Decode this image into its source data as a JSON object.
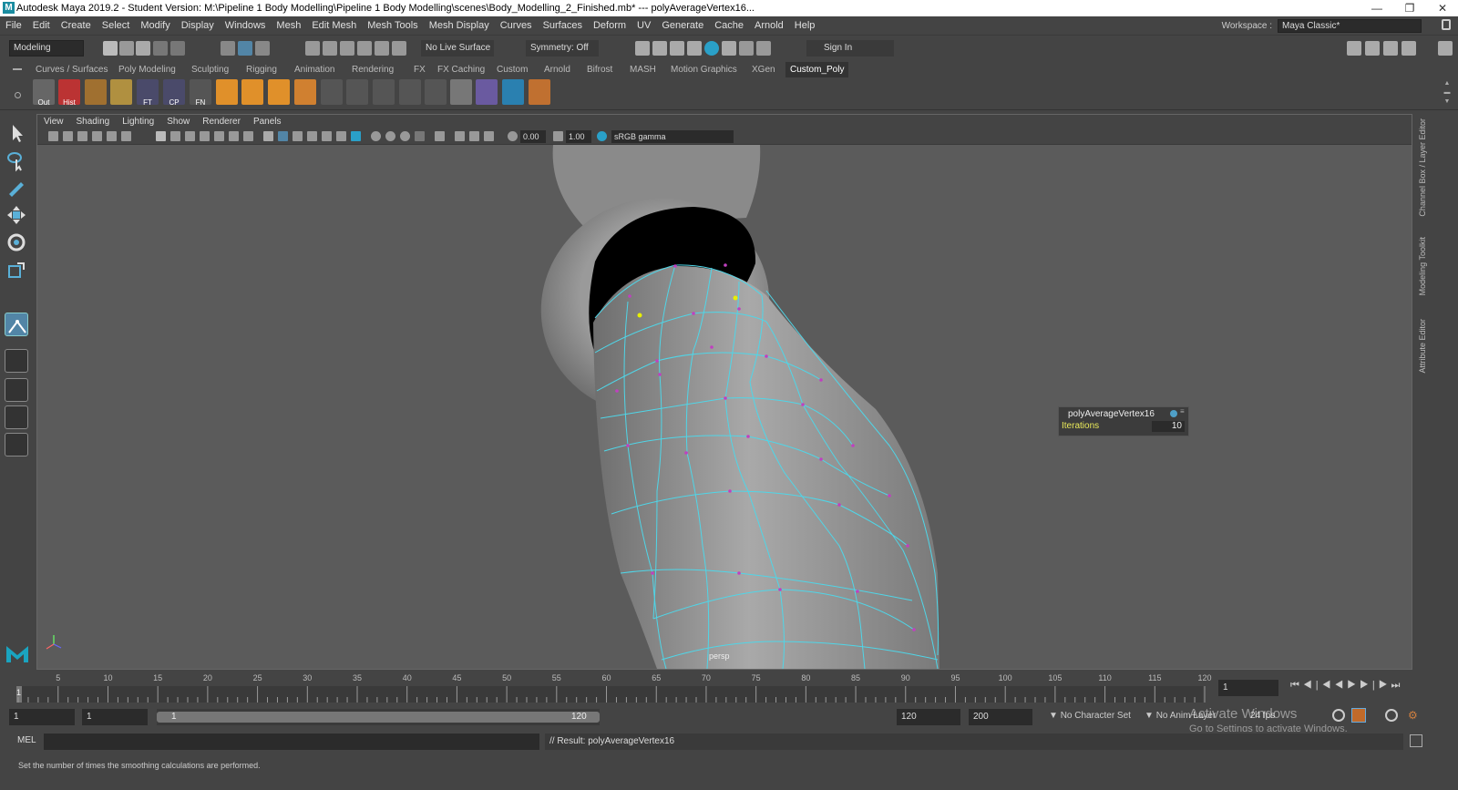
{
  "window": {
    "title": "Autodesk Maya 2019.2 - Student Version: M:\\Pipeline 1 Body Modelling\\Pipeline 1 Body Modelling\\scenes\\Body_Modelling_2_Finished.mb*   ---   polyAverageVertex16...",
    "min_icon": "minimize-icon",
    "max_icon": "maximize-icon",
    "close_icon": "close-icon"
  },
  "menu": [
    "File",
    "Edit",
    "Create",
    "Select",
    "Modify",
    "Display",
    "Windows",
    "Mesh",
    "Edit Mesh",
    "Mesh Tools",
    "Mesh Display",
    "Curves",
    "Surfaces",
    "Deform",
    "UV",
    "Generate",
    "Cache",
    "Arnold",
    "Help"
  ],
  "workspace": {
    "label": "Workspace :",
    "value": "Maya Classic*"
  },
  "status": {
    "mode": "Modeling",
    "live_surface": "No Live Surface",
    "symmetry": "Symmetry: Off",
    "sign_in": "Sign In"
  },
  "shelf_tabs": [
    "Curves / Surfaces",
    "Poly Modeling",
    "Sculpting",
    "Rigging",
    "Animation",
    "Rendering",
    "FX",
    "FX Caching",
    "Custom",
    "Arnold",
    "Bifrost",
    "MASH",
    "Motion Graphics",
    "XGen",
    "Custom_Poly"
  ],
  "shelf_active": "Custom_Poly",
  "shelf_icons": [
    "Out",
    "Hist",
    "",
    "",
    "FT",
    "CP",
    "FN"
  ],
  "viewport": {
    "menu": [
      "View",
      "Shading",
      "Lighting",
      "Show",
      "Renderer",
      "Panels"
    ],
    "exposure": "0.00",
    "gamma": "1.00",
    "colorspace": "sRGB gamma",
    "camera": "persp"
  },
  "hud": {
    "node": "polyAverageVertex16",
    "attr": "Iterations",
    "value": "10"
  },
  "right_panels": [
    "Channel Box / Layer Editor",
    "Modeling Toolkit",
    "Attribute Editor"
  ],
  "timeline": {
    "ticks": [
      "5",
      "10",
      "15",
      "20",
      "25",
      "30",
      "35",
      "40",
      "45",
      "50",
      "55",
      "60",
      "65",
      "70",
      "75",
      "80",
      "85",
      "90",
      "95",
      "100",
      "105",
      "110",
      "115",
      "120"
    ],
    "current_frame": "1",
    "current_field": "1"
  },
  "range": {
    "start": "1",
    "playback_start": "1",
    "slider_start": "1",
    "slider_end": "120",
    "playback_end": "120",
    "end": "200",
    "character_set": "No Character Set",
    "anim_layer": "No Anim Layer",
    "fps": "24 fps"
  },
  "activate_windows": {
    "title": "Activate Windows",
    "subtitle": "Go to Settings to activate Windows."
  },
  "cmd": {
    "lang": "MEL",
    "result": "// Result: polyAverageVertex16"
  },
  "help_line": "Set the number of times the smoothing calculations are performed.",
  "colors": {
    "accent": "#5285a6",
    "wire": "#4fd6e8",
    "vertex": "#c040c0",
    "selected_vertex": "#e8f000"
  }
}
